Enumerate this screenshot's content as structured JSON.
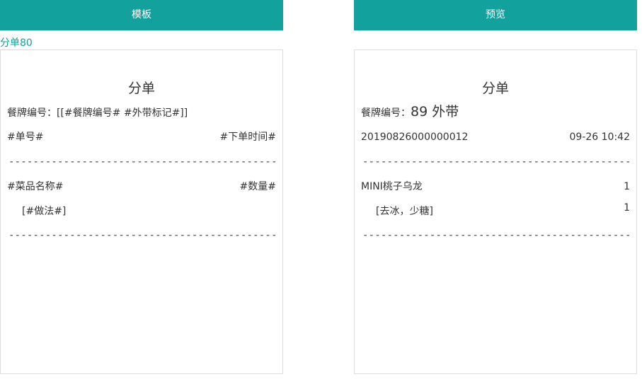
{
  "colors": {
    "header_bg": "#13a19d",
    "accent_text": "#13a19d"
  },
  "headers": {
    "template": "模板",
    "preview": "预览"
  },
  "sub_label": "分单80",
  "template_card": {
    "title": "分单",
    "ticket_label": "餐牌编号：",
    "ticket_value": "[[#餐牌编号# #外带标记#]]",
    "order_no": "#单号#",
    "order_time": "#下单时间#",
    "divider": "-------------------------------------------------------------------------",
    "dish_name": "#菜品名称#",
    "quantity": "#数量#",
    "method": "[#做法#]"
  },
  "preview_card": {
    "title": "分单",
    "ticket_label": "餐牌编号：",
    "ticket_value": "89 外带",
    "order_no": "20190826000000012",
    "order_time": "09-26 10:42",
    "divider": "-------------------------------------------------------------------------",
    "dish_name": "MINI桃子乌龙",
    "quantity": "1",
    "method": "[去冰，少糖]",
    "method_quantity": "1"
  }
}
